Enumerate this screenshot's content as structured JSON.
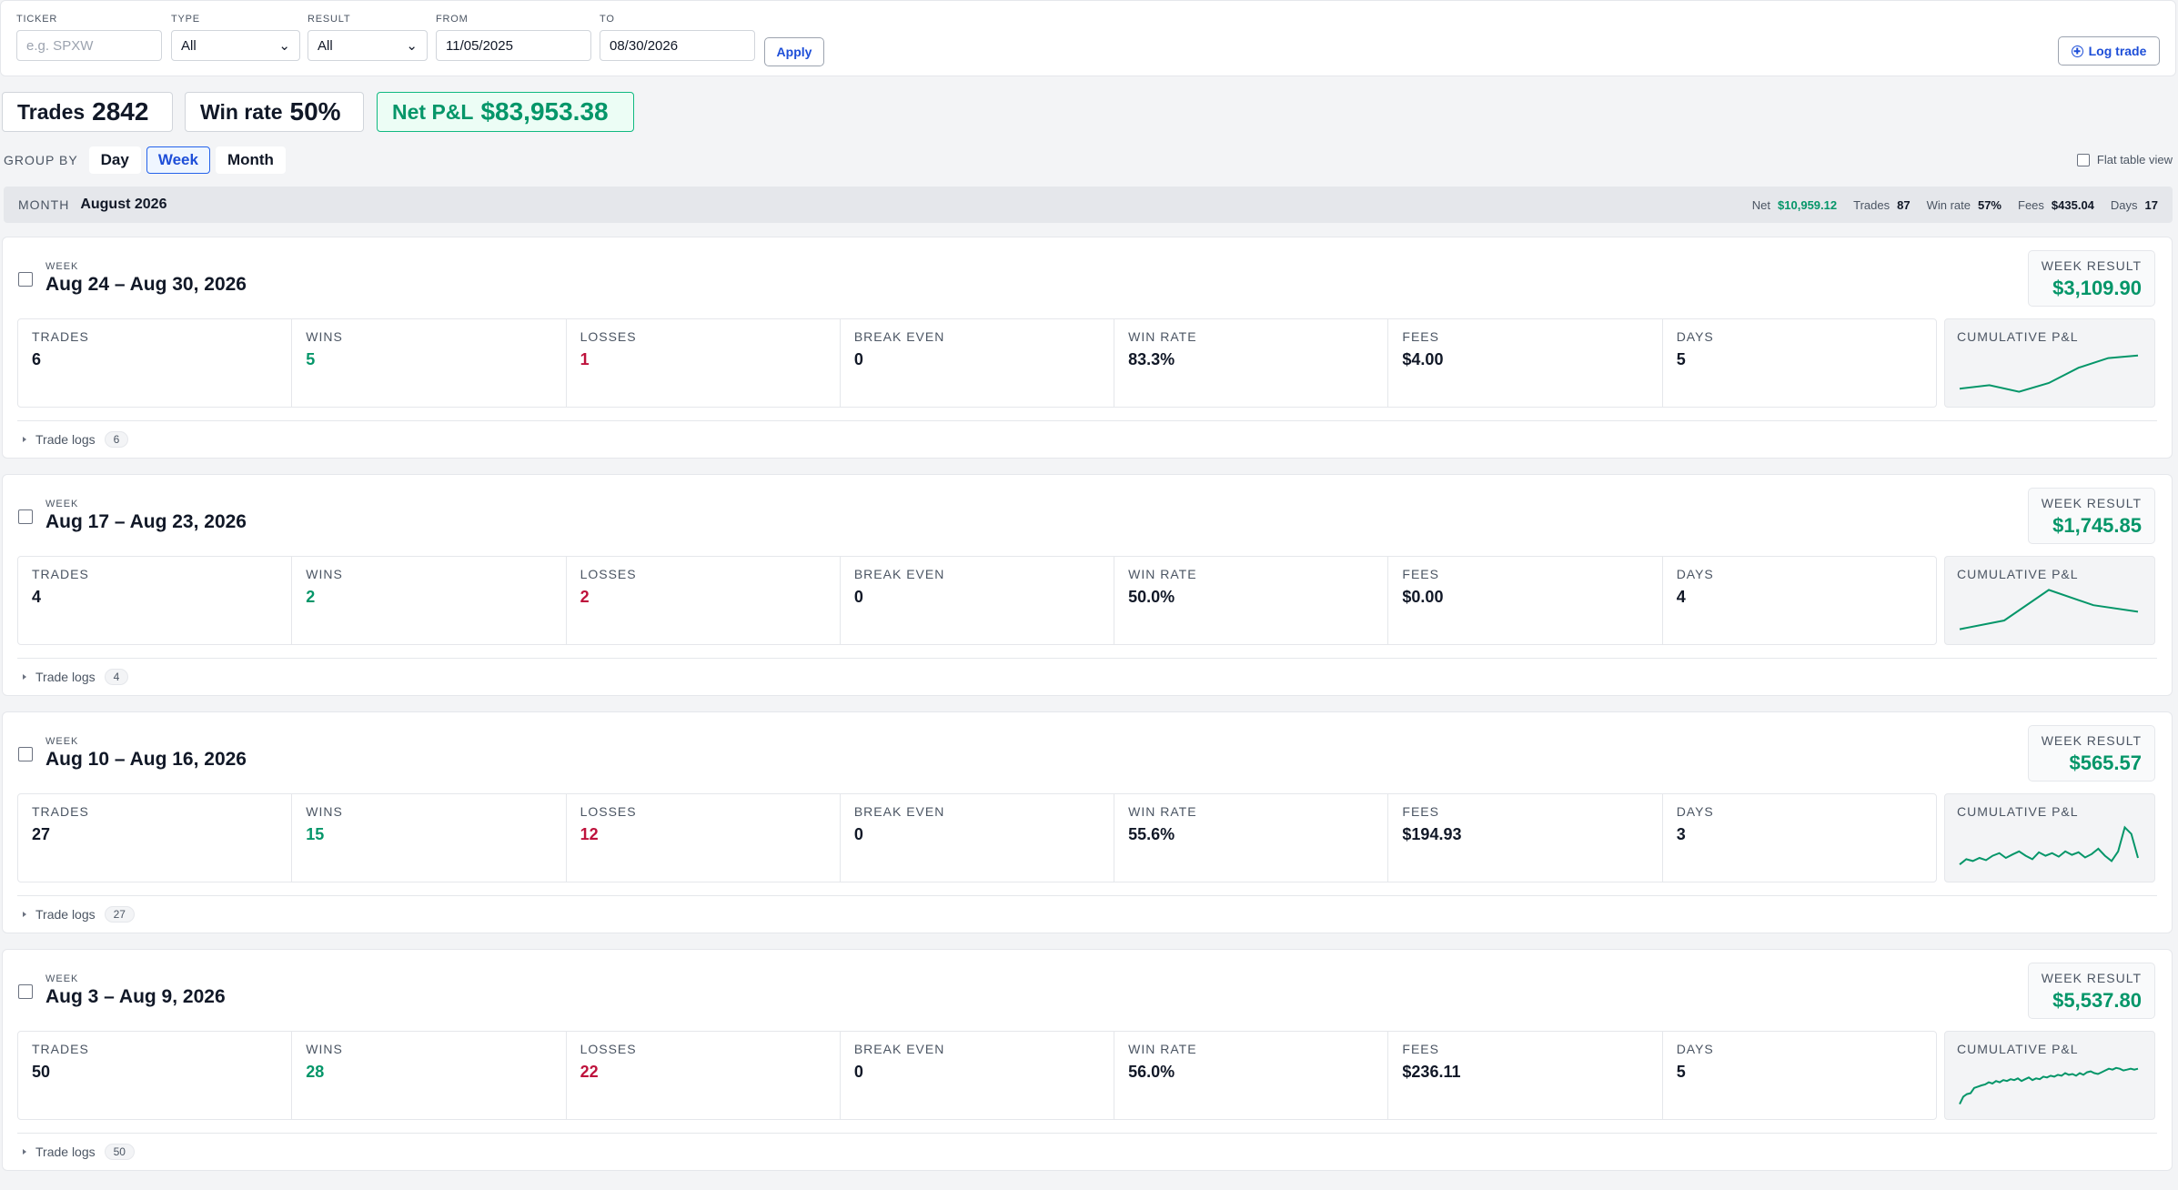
{
  "filters": {
    "ticker": {
      "label": "TICKER",
      "placeholder": "e.g. SPXW",
      "value": ""
    },
    "type": {
      "label": "TYPE",
      "value": "All"
    },
    "result": {
      "label": "RESULT",
      "value": "All"
    },
    "from": {
      "label": "FROM",
      "value": "11/05/2025"
    },
    "to": {
      "label": "TO",
      "value": "08/30/2026"
    },
    "apply_label": "Apply",
    "log_trade_label": "Log trade"
  },
  "summary": {
    "trades_label": "Trades",
    "trades_value": "2842",
    "winrate_label": "Win rate",
    "winrate_value": "50%",
    "net_label": "Net P&L",
    "net_value": "$83,953.38"
  },
  "groupby": {
    "label": "GROUP BY",
    "options": [
      "Day",
      "Week",
      "Month"
    ],
    "active": "Week",
    "flat_label": "Flat table view"
  },
  "month": {
    "label": "MONTH",
    "value": "August 2026",
    "net_label": "Net",
    "net": "$10,959.12",
    "trades_label": "Trades",
    "trades": "87",
    "winrate_label": "Win rate",
    "winrate": "57%",
    "fees_label": "Fees",
    "fees": "$435.04",
    "days_label": "Days",
    "days": "17"
  },
  "labels": {
    "week": "WEEK",
    "week_result": "WEEK RESULT",
    "trades": "TRADES",
    "wins": "WINS",
    "losses": "LOSSES",
    "break_even": "BREAK EVEN",
    "win_rate": "WIN RATE",
    "fees": "FEES",
    "days": "DAYS",
    "cumulative": "CUMULATIVE P&L",
    "trade_logs": "Trade logs"
  },
  "weeks": [
    {
      "title": "Aug 24 – Aug 30, 2026",
      "result": "$3,109.90",
      "trades": "6",
      "wins": "5",
      "losses": "1",
      "break_even": "0",
      "win_rate": "83.3%",
      "fees": "$4.00",
      "days": "5",
      "log_count": "6",
      "spark": [
        0.12,
        0.2,
        0.05,
        0.25,
        0.6,
        0.82,
        0.88
      ]
    },
    {
      "title": "Aug 17 – Aug 23, 2026",
      "result": "$1,745.85",
      "trades": "4",
      "wins": "2",
      "losses": "2",
      "break_even": "0",
      "win_rate": "50.0%",
      "fees": "$0.00",
      "days": "4",
      "log_count": "4",
      "spark": [
        0.05,
        0.25,
        0.95,
        0.6,
        0.45
      ]
    },
    {
      "title": "Aug 10 – Aug 16, 2026",
      "result": "$565.57",
      "trades": "27",
      "wins": "15",
      "losses": "12",
      "break_even": "0",
      "win_rate": "55.6%",
      "fees": "$194.93",
      "days": "3",
      "log_count": "27",
      "spark": [
        0.1,
        0.22,
        0.18,
        0.25,
        0.2,
        0.3,
        0.36,
        0.25,
        0.33,
        0.4,
        0.3,
        0.22,
        0.38,
        0.3,
        0.36,
        0.28,
        0.4,
        0.32,
        0.38,
        0.26,
        0.34,
        0.46,
        0.3,
        0.18,
        0.4,
        0.95,
        0.8,
        0.25
      ]
    },
    {
      "title": "Aug 3 – Aug 9, 2026",
      "result": "$5,537.80",
      "trades": "50",
      "wins": "28",
      "losses": "22",
      "break_even": "0",
      "win_rate": "56.0%",
      "fees": "$236.11",
      "days": "5",
      "log_count": "50",
      "spark": [
        0.05,
        0.22,
        0.28,
        0.3,
        0.42,
        0.45,
        0.48,
        0.5,
        0.55,
        0.52,
        0.58,
        0.55,
        0.6,
        0.58,
        0.62,
        0.6,
        0.64,
        0.58,
        0.62,
        0.66,
        0.6,
        0.64,
        0.62,
        0.68,
        0.66,
        0.7,
        0.68,
        0.72,
        0.7,
        0.76,
        0.72,
        0.74,
        0.7,
        0.76,
        0.72,
        0.78,
        0.8,
        0.76,
        0.74,
        0.78,
        0.82,
        0.86,
        0.84,
        0.88,
        0.86,
        0.82,
        0.84,
        0.86,
        0.84,
        0.86
      ]
    }
  ],
  "colors": {
    "green": "#059669",
    "red": "#be123c",
    "accent": "#1d4ed8",
    "spark": "#059669"
  }
}
